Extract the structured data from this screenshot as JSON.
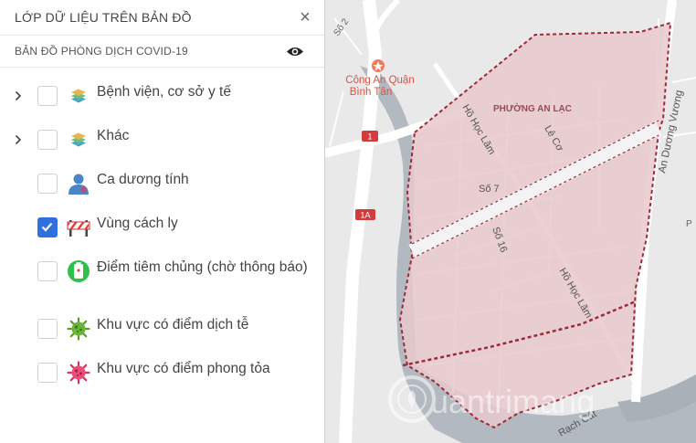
{
  "panel": {
    "title": "LỚP DỮ LIỆU TRÊN BẢN ĐỒ",
    "close_icon": "×",
    "group": {
      "title": "BẢN ĐỒ PHÒNG DỊCH COVID-19",
      "visibility_icon": "eye-icon"
    },
    "layers": [
      {
        "label": "Bệnh viện, cơ sở y tế",
        "icon": "layers-icon",
        "expandable": true,
        "checked": false
      },
      {
        "label": "Khác",
        "icon": "layers-icon",
        "expandable": true,
        "checked": false
      },
      {
        "label": "Ca dương tính",
        "icon": "person-icon",
        "expandable": false,
        "checked": false
      },
      {
        "label": "Vùng cách ly",
        "icon": "barrier-icon",
        "expandable": false,
        "checked": true
      },
      {
        "label": "Điểm tiêm chủng (chờ thông báo)",
        "icon": "vaccine-icon",
        "expandable": false,
        "checked": false
      },
      {
        "label": "Khu vực có điểm dịch tễ",
        "icon": "virus-green-icon",
        "expandable": false,
        "checked": false
      },
      {
        "label": "Khu vực có điểm phong tỏa",
        "icon": "virus-pink-icon",
        "expandable": false,
        "checked": false
      }
    ]
  },
  "map": {
    "labels": {
      "police": "Công An Quận",
      "police2": "Bình Tân",
      "ward": "PHƯỜNG AN LẠC",
      "street_ho_hoc_lam_1": "Hồ Học Lãm",
      "street_ho_hoc_lam_2": "Hồ Học Lãm",
      "street_le_co": "Lê Cơ",
      "street_so7": "Số 7",
      "street_so16": "Số 16",
      "street_an_duong_vuong": "An Dương Vương",
      "street_rach_cat": "Rạch Cát",
      "route1": "1",
      "route1a": "1A",
      "so2": "Số 2",
      "edge_p": "P",
      "watermark": "uantrimang"
    },
    "colors": {
      "zone_fill": "#e8c9cd",
      "zone_border": "#9c2a3a",
      "water": "#a9b0b8",
      "road": "#ffffff"
    }
  }
}
